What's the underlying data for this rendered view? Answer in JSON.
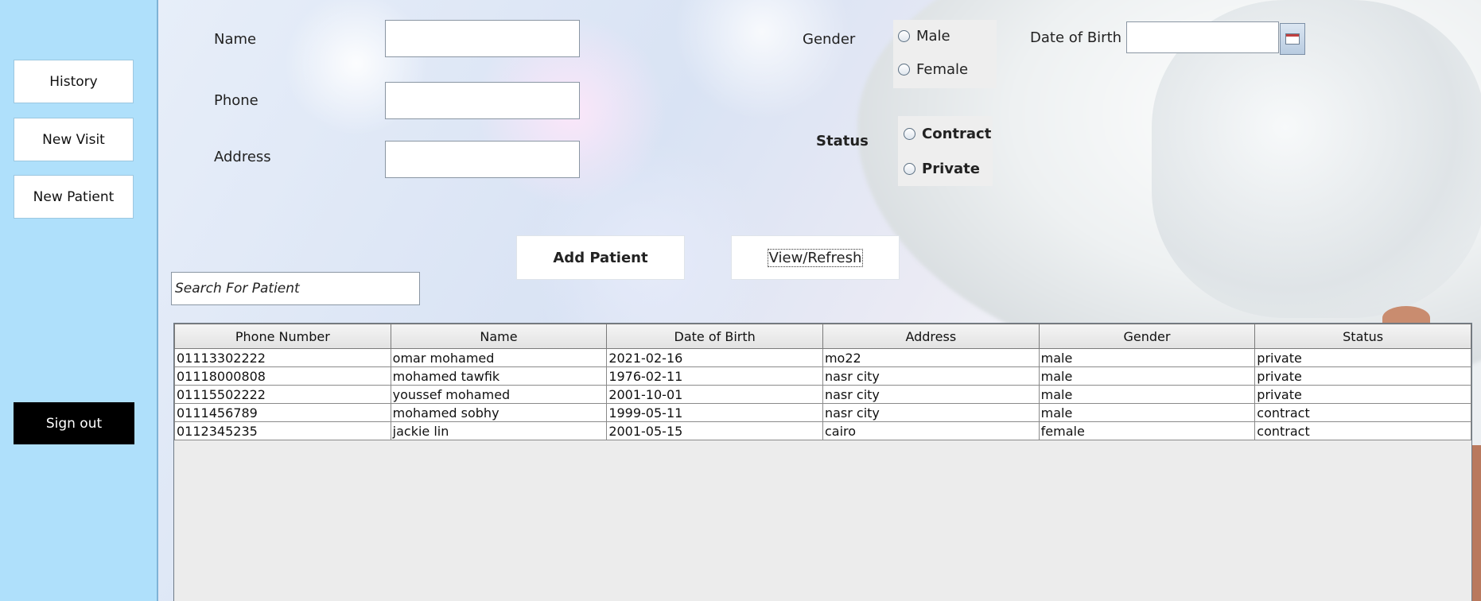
{
  "sidebar": {
    "history_label": "History",
    "new_visit_label": "New Visit",
    "new_patient_label": "New Patient",
    "sign_out_label": "Sign out"
  },
  "form": {
    "name_label": "Name",
    "phone_label": "Phone",
    "address_label": "Address",
    "name_value": "",
    "phone_value": "",
    "address_value": "",
    "gender_label": "Gender",
    "gender_options": [
      "Male",
      "Female"
    ],
    "dob_label": "Date of Birth",
    "dob_value": "",
    "status_label": "Status",
    "status_options": [
      "Contract",
      "Private"
    ]
  },
  "actions": {
    "add_patient_label": "Add Patient",
    "view_refresh_label": "View/Refresh"
  },
  "search": {
    "placeholder": "Search For Patient"
  },
  "table": {
    "columns": [
      "Phone Number",
      "Name",
      "Date of Birth",
      "Address",
      "Gender",
      "Status"
    ],
    "rows": [
      [
        "01113302222",
        "omar mohamed",
        "2021-02-16",
        "mo22",
        "male",
        "private"
      ],
      [
        "01118000808",
        "mohamed tawfik",
        "1976-02-11",
        "nasr city",
        "male",
        "private"
      ],
      [
        "01115502222",
        "youssef mohamed",
        "2001-10-01",
        "nasr city",
        "male",
        "private"
      ],
      [
        "0111456789",
        "mohamed sobhy",
        "1999-05-11",
        "nasr city",
        "male",
        "contract"
      ],
      [
        "0112345235",
        "jackie lin",
        "2001-05-15",
        "cairo",
        "female",
        "contract"
      ]
    ]
  },
  "colors": {
    "sidebar_bg": "#afe0fb",
    "sign_out_bg": "#000000",
    "sign_out_text": "#ffffff"
  },
  "icons": {
    "date_picker": "calendar-icon"
  }
}
